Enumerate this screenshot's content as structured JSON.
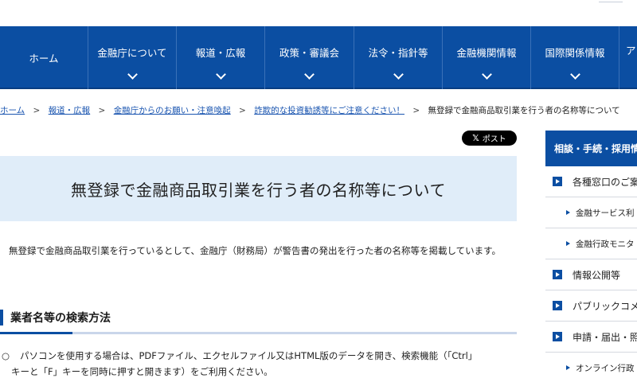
{
  "nav": {
    "items": [
      {
        "label": "ホーム",
        "chevron": false
      },
      {
        "label": "金融庁について",
        "chevron": true
      },
      {
        "label": "報道・広報",
        "chevron": true
      },
      {
        "label": "政策・審議会",
        "chevron": true
      },
      {
        "label": "法令・指針等",
        "chevron": true
      },
      {
        "label": "金融機関情報",
        "chevron": true
      },
      {
        "label": "国際関係情報",
        "chevron": true
      },
      {
        "label": "ア",
        "chevron": false
      }
    ]
  },
  "breadcrumb": {
    "items": [
      "ホーム",
      "報道・広報",
      "金融庁からのお願い・注意喚起",
      "詐欺的な投資勧誘等にご注意ください！"
    ],
    "separator": ">",
    "current": "無登録で金融商品取引業を行う者の名称等について"
  },
  "share": {
    "x_glyph": "𝕏",
    "post_label": "ポスト"
  },
  "page": {
    "title": "無登録で金融商品取引業を行う者の名称等について",
    "lead": "無登録で金融商品取引業を行っているとして、金融庁（財務局）が警告書の発出を行った者の名称等を掲載しています。"
  },
  "section": {
    "heading": "業者名等の検索方法",
    "item_mark": "○",
    "item_line1": "パソコンを使用する場合は、PDFファイル、エクセルファイル又はHTML版のデータを開き、検索機能（「Ctrl」",
    "item_line2": "キーと「F」キーを同時に押すと開きます）をご利用ください。"
  },
  "sidebar": {
    "heading": "相談・手続・採用情",
    "rows": [
      {
        "label": "各種窓口のご案",
        "sub": false
      },
      {
        "label": "金融サービス利",
        "sub": true
      },
      {
        "label": "金融行政モニタ",
        "sub": true
      },
      {
        "label": "情報公開等",
        "sub": false
      },
      {
        "label": "パブリックコメ",
        "sub": false
      },
      {
        "label": "申請・届出・照",
        "sub": false
      },
      {
        "label": "オンライン行政",
        "sub": true
      }
    ]
  },
  "colors": {
    "accent": "#0b4ea2",
    "title_bg": "#e0edf9",
    "link": "#1a55b0"
  }
}
